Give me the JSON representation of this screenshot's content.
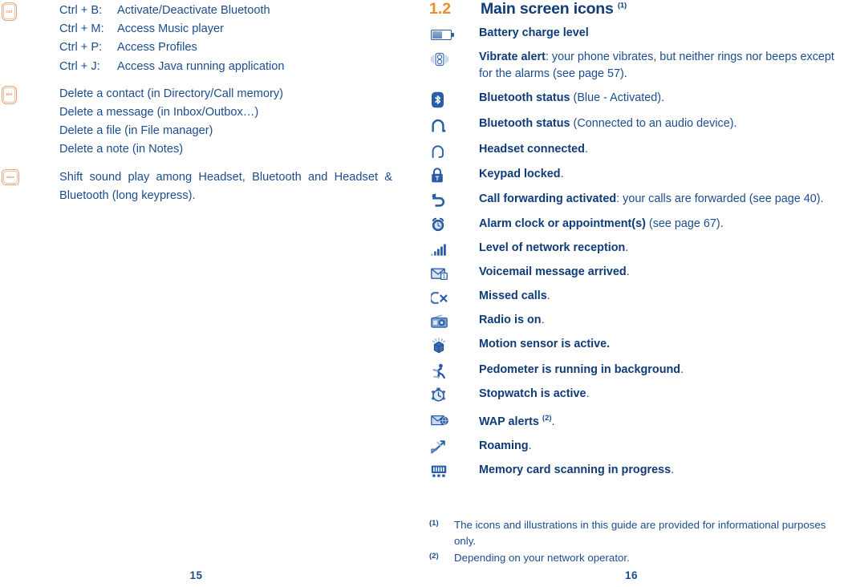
{
  "document": {
    "type": "user-guide-spread",
    "colors": {
      "text_blue": "#1B4D8E",
      "heading_blue": "#0F3C78",
      "accent_orange": "#EE8B2B",
      "icon_blue": "#2A5CA8",
      "key_outline_orange": "#E8A070",
      "page_background": "#FFFFFF"
    }
  },
  "left_page": {
    "folio": "15",
    "blocks": [
      {
        "key_icon_label": "Ctrl",
        "key_icon_name": "ctrl-key-icon",
        "lines": [
          {
            "combo": "Ctrl + B:",
            "action": "Activate/Deactivate Bluetooth"
          },
          {
            "combo": "Ctrl + M:",
            "action": "Access Music player"
          },
          {
            "combo": "Ctrl + P:",
            "action": "Access Profiles"
          },
          {
            "combo": "Ctrl + J:",
            "action": "Access Java running application"
          }
        ]
      },
      {
        "key_icon_label": "Del",
        "key_icon_name": "del-key-icon",
        "lines": [
          {
            "combo": "",
            "action": "Delete a contact (in Directory/Call memory)"
          },
          {
            "combo": "",
            "action": "Delete a message (in Inbox/Outbox…)"
          },
          {
            "combo": "",
            "action": "Delete a file (in File manager)"
          },
          {
            "combo": "",
            "action": "Delete a note (in Notes)"
          }
        ]
      },
      {
        "key_icon_label": "Case",
        "key_icon_name": "case-key-icon",
        "paragraph": "Shift sound play among Headset, Bluetooth and Headset & Bluetooth (long keypress)."
      }
    ]
  },
  "right_page": {
    "folio": "16",
    "section": {
      "number": "1.2",
      "title": "Main screen icons",
      "footnote_mark": "(1)"
    },
    "icon_rows": [
      {
        "icon": "battery-icon",
        "bold": "Battery charge level",
        "rest": ""
      },
      {
        "icon": "vibrate-alert-icon",
        "bold": "Vibrate alert",
        "rest": ": your phone vibrates, but neither rings nor beeps except for the alarms (see page 57)."
      },
      {
        "icon": "bluetooth-icon",
        "bold": "Bluetooth status",
        "rest": " (Blue - Activated)."
      },
      {
        "icon": "bluetooth-audio-icon",
        "bold": "Bluetooth status",
        "rest": " (Connected to an audio device)."
      },
      {
        "icon": "headset-icon",
        "bold": "Headset connected",
        "rest": "."
      },
      {
        "icon": "keypad-lock-icon",
        "bold": "Keypad locked",
        "rest": "."
      },
      {
        "icon": "call-forwarding-icon",
        "bold": "Call forwarding activated",
        "rest": ": your calls are forwarded (see page 40)."
      },
      {
        "icon": "alarm-clock-icon",
        "bold": "Alarm clock or appointment(s)",
        "rest": " (see page 67)."
      },
      {
        "icon": "network-signal-icon",
        "bold": "Level of network reception",
        "rest": "."
      },
      {
        "icon": "voicemail-icon",
        "bold": "Voicemail message arrived",
        "rest": "."
      },
      {
        "icon": "missed-calls-icon",
        "bold": "Missed calls",
        "rest": "."
      },
      {
        "icon": "radio-icon",
        "bold": "Radio is on",
        "rest": "."
      },
      {
        "icon": "motion-sensor-icon",
        "bold": "Motion sensor is active.",
        "rest": ""
      },
      {
        "icon": "pedometer-icon",
        "bold": "Pedometer is running in background",
        "rest": "."
      },
      {
        "icon": "stopwatch-icon",
        "bold": "Stopwatch is active",
        "rest": "."
      },
      {
        "icon": "wap-alerts-icon",
        "bold": "WAP alerts",
        "rest": " (2).",
        "sup": "(2)"
      },
      {
        "icon": "roaming-icon",
        "bold": "Roaming",
        "rest": "."
      },
      {
        "icon": "memory-card-icon",
        "bold": "Memory card scanning in progress",
        "rest": "."
      }
    ],
    "footnotes": [
      {
        "mark": "(1)",
        "text": "The icons and illustrations in this guide are provided for informational purposes only."
      },
      {
        "mark": "(2)",
        "text": "Depending on your network operator."
      }
    ]
  }
}
